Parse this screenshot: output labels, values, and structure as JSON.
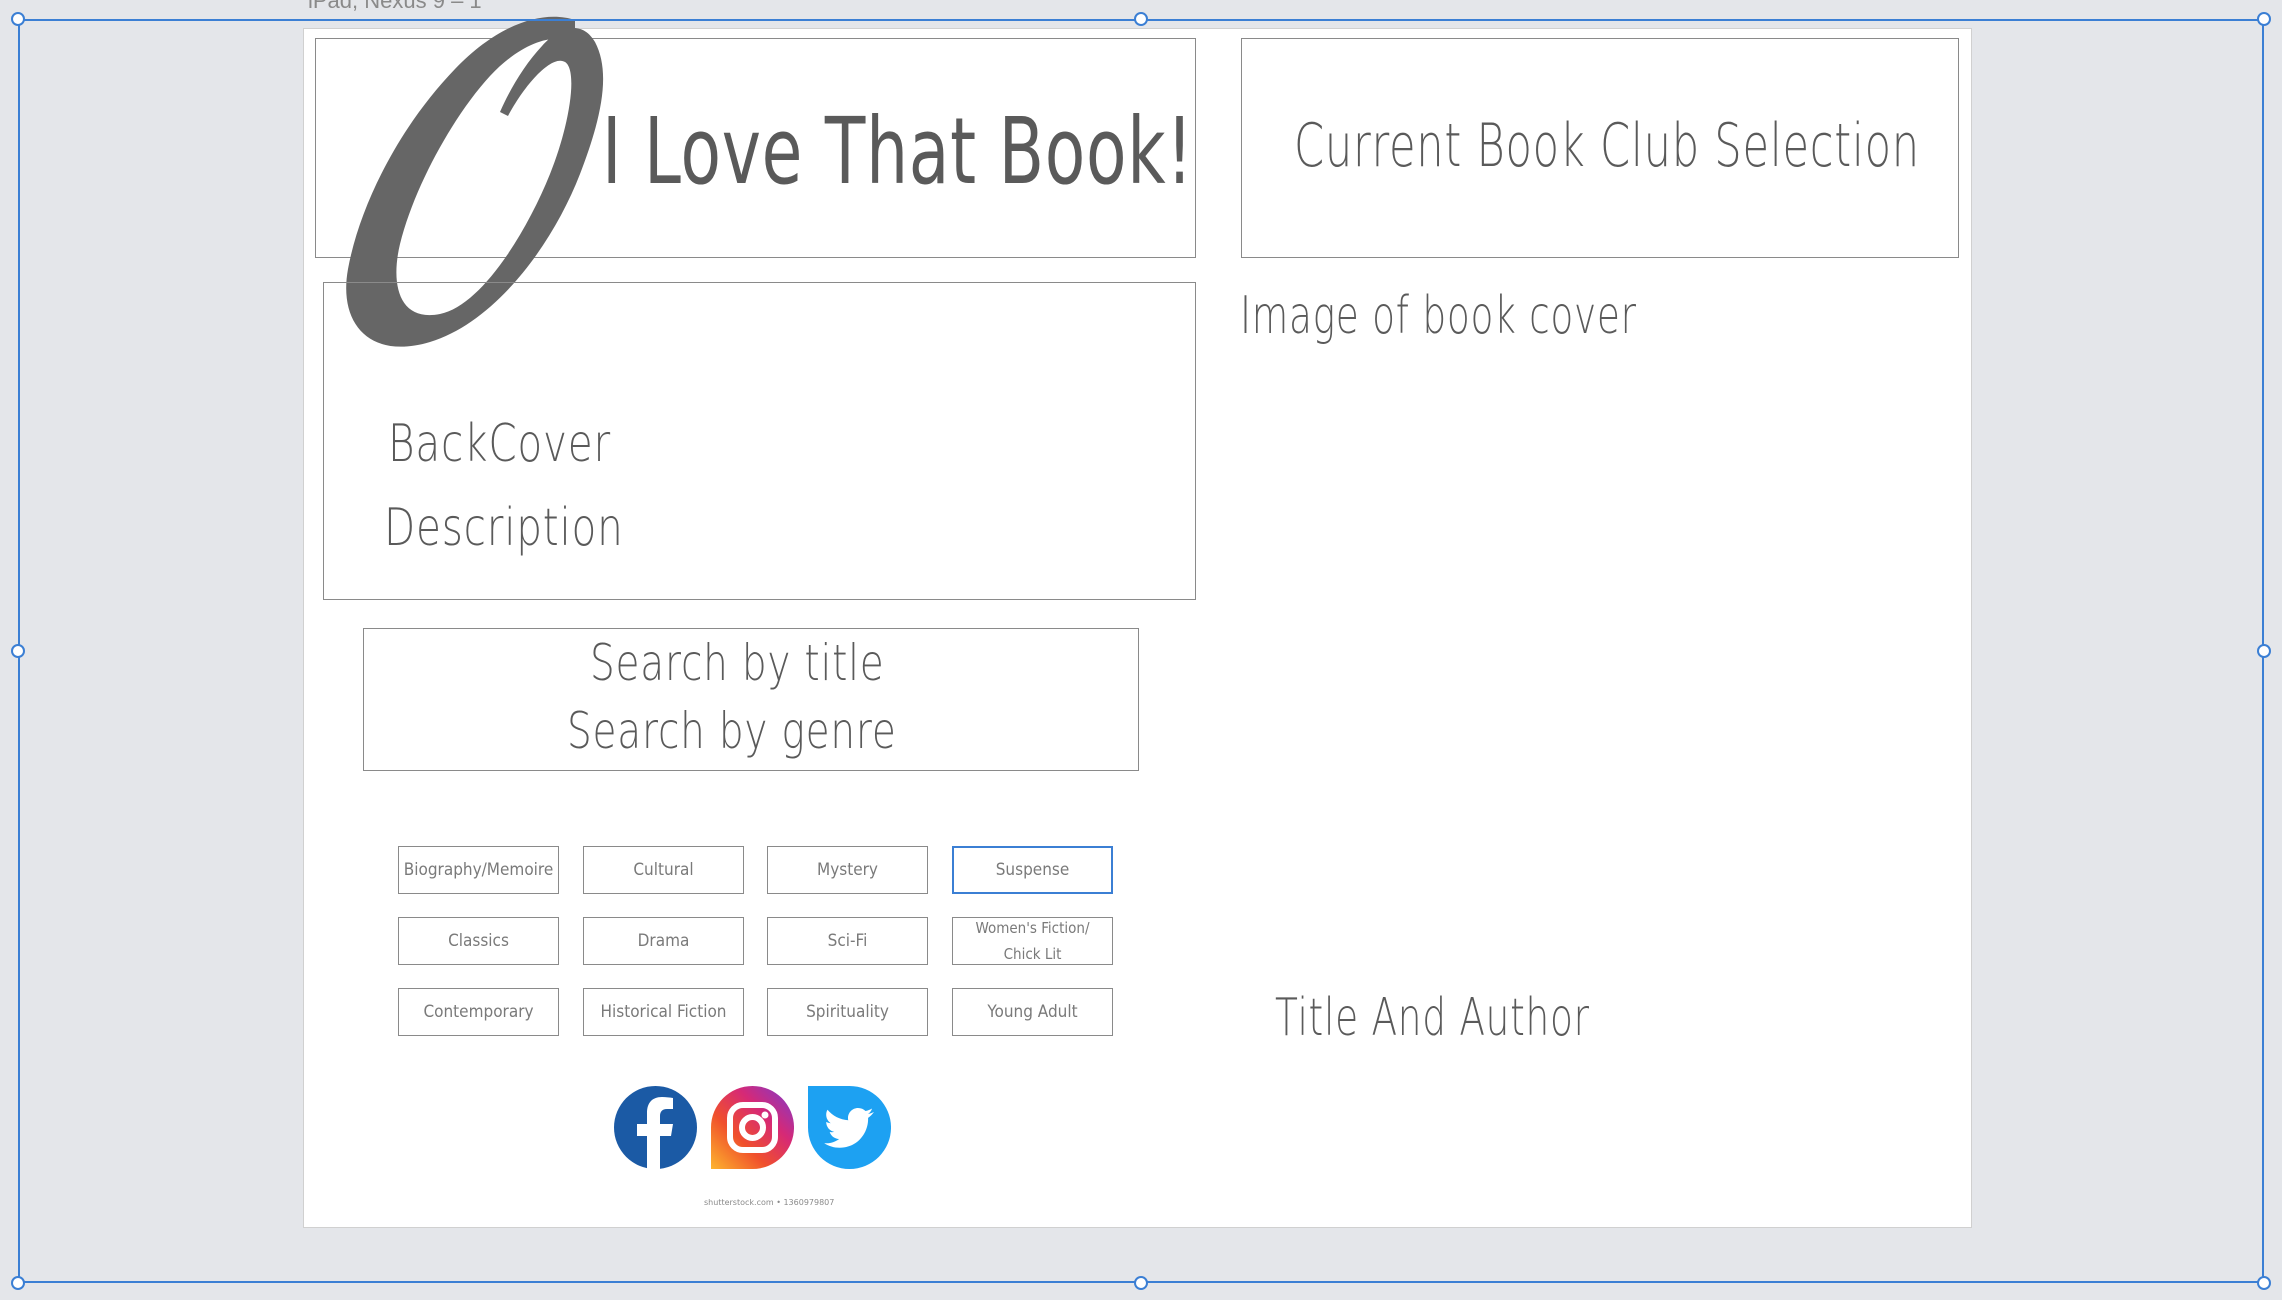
{
  "artboard": {
    "title": "iPad, Nexus 9 – 1"
  },
  "header": {
    "headline": "I Love That Book!",
    "logo_letter": "O"
  },
  "current": {
    "title": "Current Book Club Selection",
    "image_label": "Image of book cover",
    "title_author": "Title And Author"
  },
  "backcover": {
    "line1": "BackCover",
    "line2": "Description"
  },
  "search": {
    "by_title": "Search by title",
    "by_genre": "Search by genre"
  },
  "genres": [
    "Biography/Memoire",
    "Cultural",
    "Mystery",
    "Suspense",
    "Classics",
    "Drama",
    "Sci-Fi",
    "Women's Fiction/ Chick Lit",
    "Contemporary",
    "Historical Fiction",
    "Spirituality",
    "Young Adult"
  ],
  "selected_genre": "Suspense",
  "social": [
    {
      "name": "Facebook",
      "icon": "facebook-icon",
      "color": "#1b5aa5"
    },
    {
      "name": "Instagram",
      "icon": "instagram-icon",
      "color": "#d62976"
    },
    {
      "name": "Twitter",
      "icon": "twitter-icon",
      "color": "#1da1f2"
    }
  ],
  "credit": "shutterstock.com • 1360979807"
}
